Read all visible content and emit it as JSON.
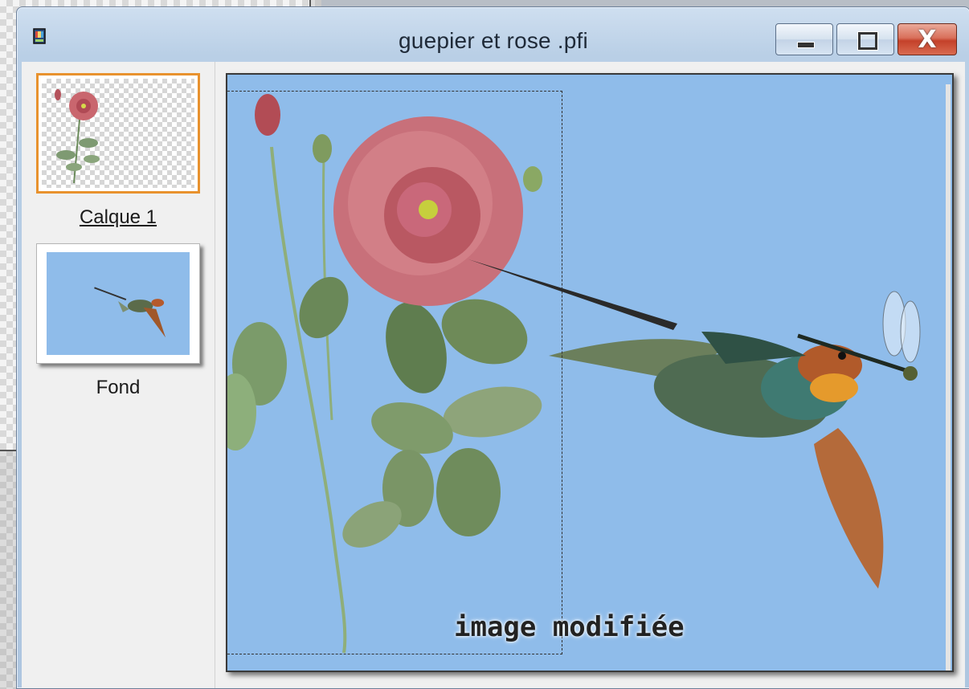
{
  "window": {
    "title": "guepier et rose  .pfi",
    "minimize_glyph": "—",
    "close_glyph": "X"
  },
  "layers": [
    {
      "label": "Calque 1",
      "selected": true
    },
    {
      "label": "Fond",
      "selected": false
    }
  ],
  "canvas": {
    "overlay_text": "image modifiée",
    "background_color": "#8fbcea"
  },
  "colors": {
    "selected_layer_border": "#e8922e",
    "close_button": "#c4412a"
  },
  "icons": {
    "app": "paint-document-icon",
    "minimize": "minimize-icon",
    "maximize": "maximize-icon",
    "close": "close-icon"
  }
}
